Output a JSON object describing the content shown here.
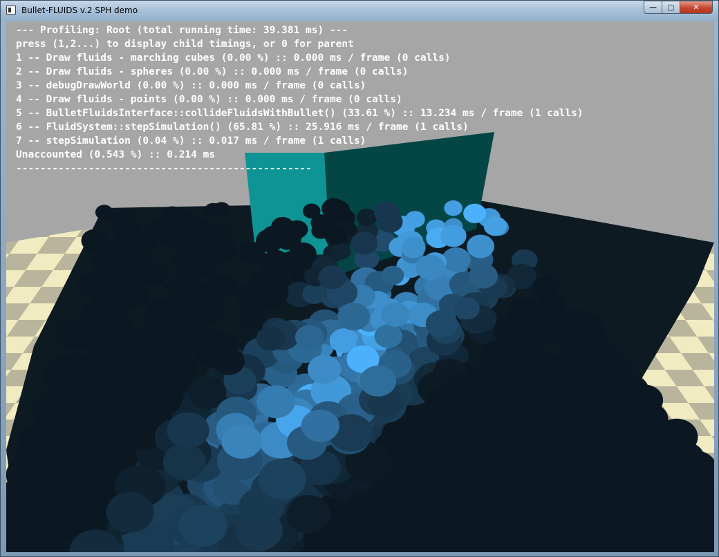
{
  "window": {
    "title": "Bullet-FLUIDS v.2 SPH demo",
    "buttons": {
      "minimize_glyph": "—",
      "maximize_glyph": "▢",
      "close_glyph": "✕"
    }
  },
  "profiler": {
    "lines": [
      "--- Profiling: Root (total running time: 39.381 ms) ---",
      "press (1,2...) to display child timings, or 0 for parent",
      "1 -- Draw fluids - marching cubes (0.00 %) :: 0.000 ms / frame (0 calls)",
      "2 -- Draw fluids - spheres (0.00 %) :: 0.000 ms / frame (0 calls)",
      "3 -- debugDrawWorld (0.00 %) :: 0.000 ms / frame (0 calls)",
      "4 -- Draw fluids - points (0.00 %) :: 0.000 ms / frame (0 calls)",
      "5 -- BulletFluidsInterface::collideFluidsWithBullet() (33.61 %) :: 13.234 ms / frame (1 calls)",
      "6 -- FluidSystem::stepSimulation() (65.81 %) :: 25.916 ms / frame (1 calls)",
      "7 -- stepSimulation (0.04 %) :: 0.017 ms / frame (1 calls)",
      "Unaccounted (0.543 %) :: 0.214 ms",
      "-------------------------------------------------"
    ]
  },
  "scene": {
    "colors": {
      "background": "#a6a6a6",
      "floor_light": "#f1ebc1",
      "floor_dark": "#b9b59c",
      "tank": "#0d1a22",
      "fluid_deep": "#0b1822",
      "fluid_light": "#4db3ff",
      "box_front": "#0e9494",
      "box_side": "#044646"
    }
  }
}
